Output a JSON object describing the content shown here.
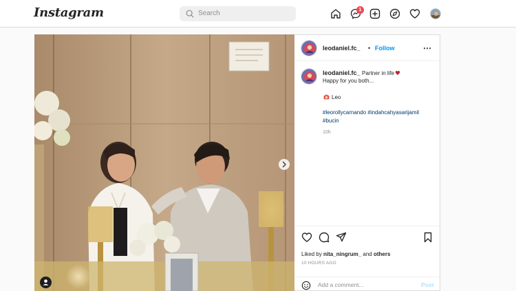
{
  "topbar": {
    "logo": "Instagram",
    "search_placeholder": "Search",
    "notification_count": "1"
  },
  "post": {
    "username": "leodaniel.fc_",
    "separator": "•",
    "follow_label": "Follow",
    "more_label": "•••",
    "caption": {
      "username": "leodaniel.fc_",
      "line1": "Partner in life",
      "line2": "Happy for you both...",
      "credit": "Leo",
      "tags_line1": "#leorollycarnando #indahcahyasarijamil",
      "tags_line2": "#bucin",
      "time": "10h"
    },
    "likes_prefix": "Liked by",
    "likes_user": "nita_ningrum_",
    "likes_and": "and",
    "likes_others": "others",
    "timestamp": "10 HOURS AGO",
    "comment_placeholder": "Add a comment...",
    "post_button": "Post"
  },
  "colors": {
    "accent": "#0095f6",
    "badge": "#ed4956",
    "link": "#00376b",
    "heart": "#c0282d"
  },
  "icons": [
    "home-icon",
    "messenger-icon",
    "new-post-icon",
    "explore-icon",
    "activity-heart-icon",
    "like-heart-icon",
    "comment-icon",
    "share-icon",
    "bookmark-icon",
    "emoji-icon",
    "camera-icon",
    "user-tag-icon",
    "next-arrow-icon"
  ]
}
